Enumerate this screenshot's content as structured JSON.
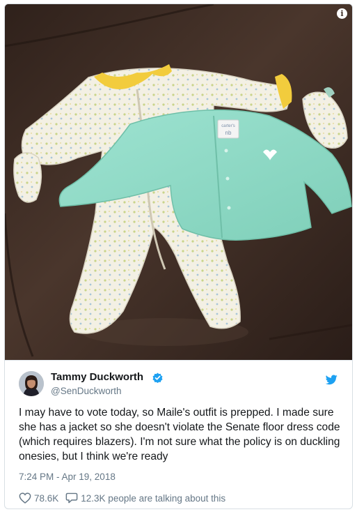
{
  "tweet": {
    "author_name": "Tammy Duckworth",
    "author_handle": "@SenDuckworth",
    "text": "I may have to vote today, so Maile's outfit is prepped. I made sure she has a jacket so she doesn't violate the Senate floor dress code (which requires blazers). I'm not sure what the policy is on duckling onesies, but I think we're ready",
    "timestamp": "7:24 PM - Apr 19, 2018",
    "likes": "78.6K",
    "talking_about": "12.3K people are talking about this"
  },
  "photo": {
    "tag_brand": "carter's",
    "tag_size": "nb",
    "info_glyph": "i"
  },
  "colors": {
    "twitter_blue": "#1da1f2",
    "leather": "#3d2c24",
    "cardigan": "#8ed9c6",
    "collar": "#f2cc3d",
    "secondary_text": "#657786"
  }
}
